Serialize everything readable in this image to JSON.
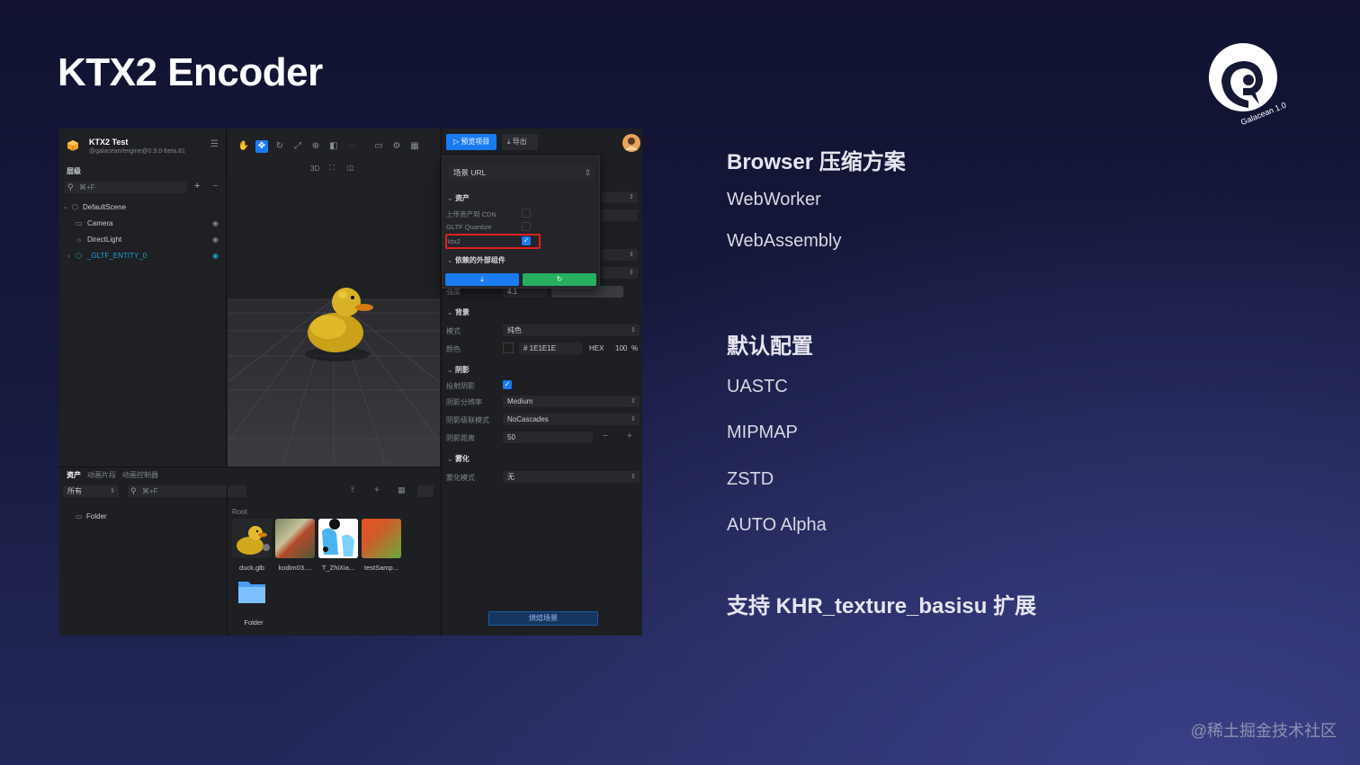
{
  "slide": {
    "title": "KTX2 Encoder",
    "logo_text": "Galacean 1.0",
    "watermark": "@稀土掘金技术社区",
    "sections": [
      {
        "heading": "Browser 压缩方案",
        "items": [
          "WebWorker",
          "WebAssembly"
        ]
      },
      {
        "heading": "默认配置",
        "items": [
          "UASTC",
          "MIPMAP",
          "ZSTD",
          "AUTO Alpha"
        ]
      },
      {
        "heading": "支持 KHR_texture_basisu 扩展",
        "items": []
      }
    ]
  },
  "editor": {
    "project": {
      "name": "KTX2 Test",
      "version": "@galacean/engine@0.9.0-beta.81"
    },
    "hierarchy": {
      "title": "层级",
      "search_placeholder": "⌘+F",
      "items": [
        "DefaultScene",
        "Camera",
        "DirectLight",
        "_GLTF_ENTITY_0"
      ]
    },
    "viewport": {
      "mode_label": "3D"
    },
    "toolbar": {
      "preview_label": "预览项目",
      "export_label": "导出"
    },
    "export_popup": {
      "url_label": "场景 URL",
      "assets_section": "资产",
      "upload_cdn_label": "上传资产到 CDN",
      "gltf_quantize_label": "GLTF Quantize",
      "ktx2_label": "ktx2",
      "deps_section": "依赖的外部组件"
    },
    "inspector": {
      "intensity_label": "强度",
      "intensity_value": "4.1",
      "background_section": "背景",
      "mode_label": "模式",
      "mode_value": "纯色",
      "color_label": "颜色",
      "color_hex": "# 1E1E1E",
      "color_format": "HEX",
      "color_alpha": "100",
      "color_alpha_unit": "%",
      "shadow_section": "阴影",
      "cast_shadow_label": "投射阴影",
      "shadow_resolution_label": "阴影分辨率",
      "shadow_resolution_value": "Medium",
      "shadow_cascade_label": "阴影级联模式",
      "shadow_cascade_value": "NoCascades",
      "shadow_distance_label": "阴影距离",
      "shadow_distance_value": "50",
      "fog_section": "雾化",
      "fog_mode_label": "雾化模式",
      "fog_mode_value": "无",
      "bottom_button": "烘焙场景"
    },
    "assets": {
      "tabs": [
        "资产",
        "动画片段",
        "动画控制器"
      ],
      "filter_value": "所有",
      "search_placeholder": "⌘+F",
      "folder_tree": "Folder",
      "root_label": "Root",
      "files": [
        "duck.glb",
        "kodim03....",
        "T_ZhiXia...",
        "testSamp...",
        "Folder"
      ]
    },
    "colors": {
      "accent": "#1a7cf0",
      "green": "#27ae60",
      "highlight": "#e0201e",
      "entity": "#1ea0d4"
    }
  }
}
